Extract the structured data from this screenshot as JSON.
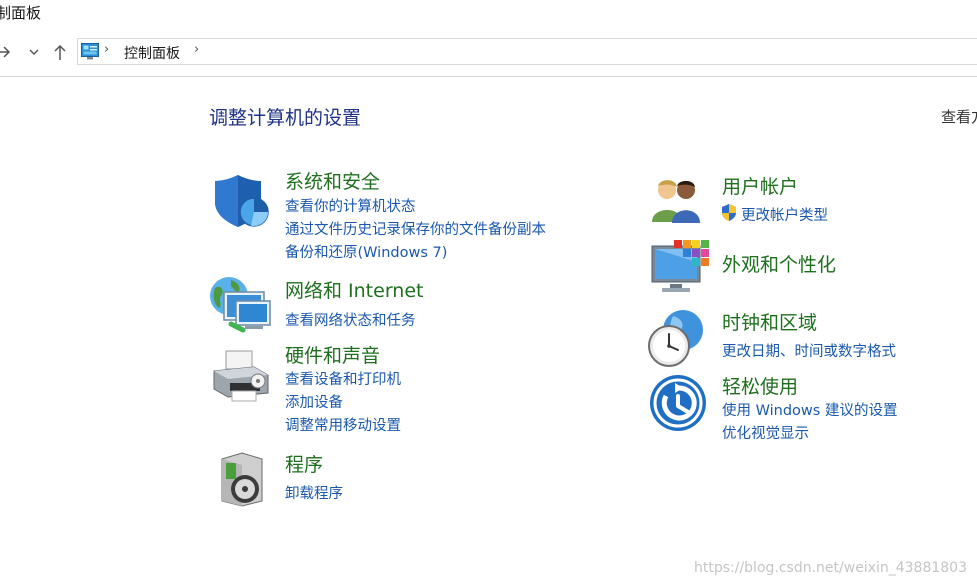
{
  "window": {
    "title_fragment": "制面板"
  },
  "nav": {
    "forward_icon": "arrow-right-icon",
    "history_icon": "chevron-down-icon",
    "up_icon": "arrow-up-icon"
  },
  "address": {
    "crumb": "控制面板"
  },
  "header": {
    "title": "调整计算机的设置",
    "view_by": "查看方"
  },
  "categories": {
    "system_security": {
      "title": "系统和安全",
      "links": [
        "查看你的计算机状态",
        "通过文件历史记录保存你的文件备份副本",
        "备份和还原(Windows 7)"
      ]
    },
    "network": {
      "title": "网络和 Internet",
      "links": [
        "查看网络状态和任务"
      ]
    },
    "hardware": {
      "title": "硬件和声音",
      "links": [
        "查看设备和打印机",
        "添加设备",
        "调整常用移动设置"
      ]
    },
    "programs": {
      "title": "程序",
      "links": [
        "卸载程序"
      ]
    },
    "user_accounts": {
      "title": "用户帐户",
      "links": [
        "更改帐户类型"
      ]
    },
    "appearance": {
      "title": "外观和个性化",
      "links": []
    },
    "clock_region": {
      "title": "时钟和区域",
      "links": [
        "更改日期、时间或数字格式"
      ]
    },
    "ease_access": {
      "title": "轻松使用",
      "links": [
        "使用 Windows 建议的设置",
        "优化视觉显示"
      ]
    }
  },
  "watermark": "https://blog.csdn.net/weixin_43881803",
  "colors": {
    "category_title": "#1e6f1e",
    "link": "#1a58ad",
    "heading": "#1e3287"
  }
}
